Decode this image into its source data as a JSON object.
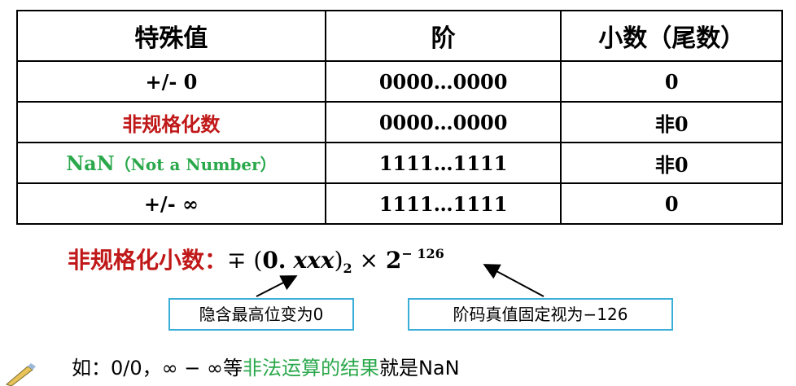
{
  "table": {
    "headers": [
      "特殊值",
      "阶",
      "小数（尾数）"
    ],
    "rows": [
      {
        "value": "+/- 0",
        "exponent": "0000…0000",
        "fraction": "0"
      },
      {
        "value": "非规格化数",
        "exponent": "0000…0000",
        "fraction": "非0"
      },
      {
        "value_main": "NaN",
        "value_sub": "（Not a Number）",
        "exponent": "1111…1111",
        "fraction": "非0"
      },
      {
        "value": "+/- ∞",
        "exponent": "1111…1111",
        "fraction": "0"
      }
    ]
  },
  "formula": {
    "label": "非规格化小数：",
    "sign": "∓",
    "open": "(",
    "zero": "0.",
    "xxx": "xxx",
    "close": ")",
    "base": "2",
    "times": "×",
    "two": "2",
    "exponent": "− 126"
  },
  "callouts": {
    "left": "隐含最高位变为0",
    "right": "阶码真值固定视为−126"
  },
  "note": {
    "prefix": "如：0/0，∞ − ∞等",
    "highlight": "非法运算的结果",
    "suffix": "就是NaN"
  },
  "colors": {
    "red": "#c01818",
    "green": "#2aa84b",
    "box_border": "#3aaed8"
  }
}
